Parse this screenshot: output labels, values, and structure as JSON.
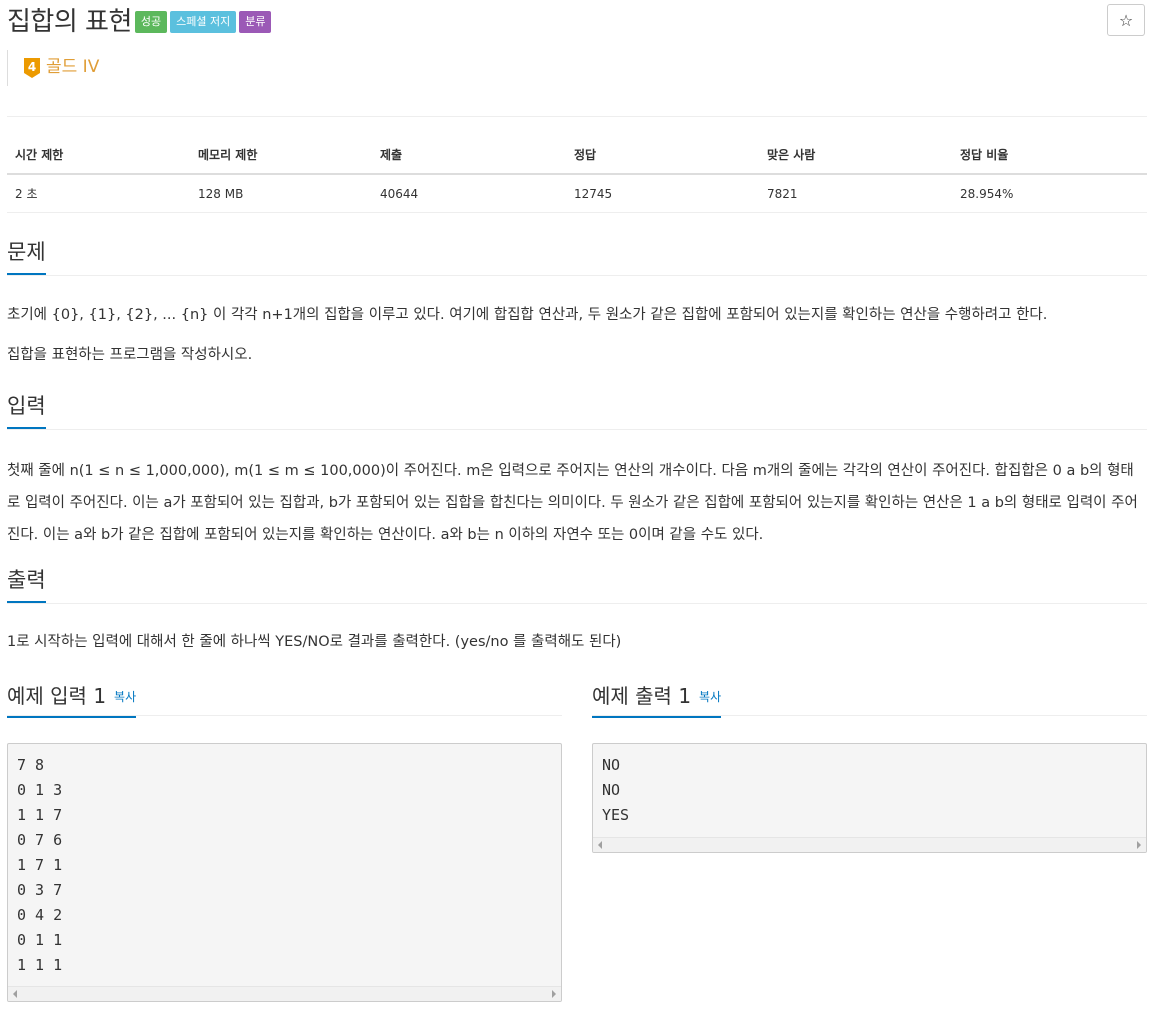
{
  "problem": {
    "title": "집합의 표현",
    "labels": [
      {
        "text": "성공",
        "color": "#5cb85c"
      },
      {
        "text": "스페셜 저지",
        "color": "#5bc0de"
      },
      {
        "text": "분류",
        "color": "#9b59b6"
      }
    ],
    "star_icon": "☆",
    "tier": {
      "number": "4",
      "text": "골드 IV",
      "color": "#e09e37"
    }
  },
  "info_table": {
    "headers": [
      "시간 제한",
      "메모리 제한",
      "제출",
      "정답",
      "맞은 사람",
      "정답 비율"
    ],
    "values": [
      "2 초",
      "128 MB",
      "40644",
      "12745",
      "7821",
      "28.954%"
    ]
  },
  "sections": {
    "description": {
      "title": "문제",
      "paragraphs": [
        "초기에 {0}, {1}, {2}, ... {n} 이 각각 n+1개의 집합을 이루고 있다. 여기에 합집합 연산과, 두 원소가 같은 집합에 포함되어 있는지를 확인하는 연산을 수행하려고 한다.",
        "집합을 표현하는 프로그램을 작성하시오."
      ]
    },
    "input": {
      "title": "입력",
      "text": "첫째 줄에 n(1 ≤ n ≤ 1,000,000), m(1 ≤ m ≤ 100,000)이 주어진다. m은 입력으로 주어지는 연산의 개수이다. 다음 m개의 줄에는 각각의 연산이 주어진다. 합집합은 0 a b의 형태로 입력이 주어진다. 이는 a가 포함되어 있는 집합과, b가 포함되어 있는 집합을 합친다는 의미이다. 두 원소가 같은 집합에 포함되어 있는지를 확인하는 연산은 1 a b의 형태로 입력이 주어진다. 이는 a와 b가 같은 집합에 포함되어 있는지를 확인하는 연산이다. a와 b는 n 이하의 자연수 또는 0이며 같을 수도 있다."
    },
    "output": {
      "title": "출력",
      "text": "1로 시작하는 입력에 대해서 한 줄에 하나씩 YES/NO로 결과를 출력한다. (yes/no 를 출력해도 된다)"
    }
  },
  "samples": {
    "input": {
      "title": "예제 입력 1",
      "copy_label": "복사",
      "lines": [
        "7 8",
        "0 1 3",
        "1 1 7",
        "0 7 6",
        "1 7 1",
        "0 3 7",
        "0 4 2",
        "0 1 1",
        "1 1 1"
      ]
    },
    "output": {
      "title": "예제 출력 1",
      "copy_label": "복사",
      "lines": [
        "NO",
        "NO",
        "YES"
      ]
    }
  }
}
